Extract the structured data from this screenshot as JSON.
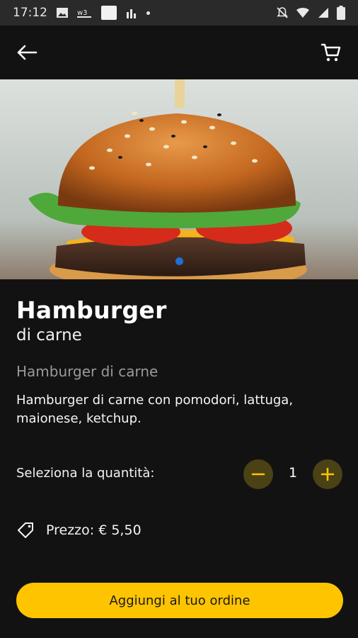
{
  "status_bar": {
    "time": "17:12",
    "icons_left": [
      "image-icon",
      "voicemail-icon",
      "app-square-icon",
      "signal-bars-icon",
      "dot-icon"
    ],
    "icons_right": [
      "mute-bell-icon",
      "wifi-icon",
      "cellular-icon",
      "battery-icon"
    ]
  },
  "app_bar": {
    "back_icon": "arrow-left-icon",
    "cart_icon": "shopping-cart-icon"
  },
  "product": {
    "title": "Hamburger",
    "subtitle": "di carne",
    "category": "Hamburger di carne",
    "description": "Hamburger di carne con pomodori, lattuga, maionese, ketchup.",
    "image_icon": "burger-photo"
  },
  "quantity": {
    "label": "Seleziona la quantità:",
    "value": "1"
  },
  "price": {
    "label": "Prezzo: € 5,50",
    "icon": "price-tag-icon"
  },
  "cta": {
    "label": "Aggiungi al tuo ordine"
  },
  "colors": {
    "background": "#121212",
    "accent": "#ffc400",
    "qty_button_bg": "#4a4115",
    "pager_active": "#1e6fd9"
  }
}
